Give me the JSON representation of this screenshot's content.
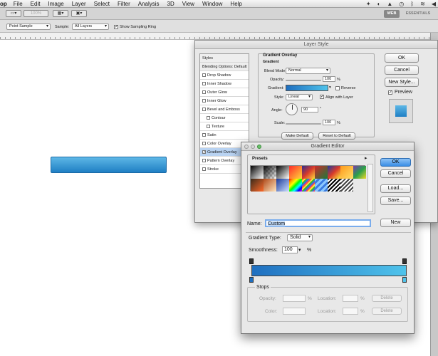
{
  "menubar": {
    "app": "op",
    "items": [
      "File",
      "Edit",
      "Image",
      "Layer",
      "Select",
      "Filter",
      "Analysis",
      "3D",
      "View",
      "Window",
      "Help"
    ]
  },
  "appbar": {
    "zoom_placeholder": "100%",
    "workspace_active": "WEB",
    "workspace_other": "ESSENTIALS"
  },
  "options": {
    "sample_size": "Point Sample",
    "sample_label": "Sample:",
    "sample_value": "All Layers",
    "ring_label": "Show Sampling Ring",
    "ring_checked": true
  },
  "layer_style": {
    "title": "Layer Style",
    "list": [
      {
        "label": "Styles",
        "type": "hdr"
      },
      {
        "label": "Blending Options: Default",
        "type": "hdr"
      },
      {
        "label": "Drop Shadow",
        "type": "chk"
      },
      {
        "label": "Inner Shadow",
        "type": "chk"
      },
      {
        "label": "Outer Glow",
        "type": "chk"
      },
      {
        "label": "Inner Glow",
        "type": "chk"
      },
      {
        "label": "Bevel and Emboss",
        "type": "chk"
      },
      {
        "label": "Contour",
        "type": "sub"
      },
      {
        "label": "Texture",
        "type": "sub"
      },
      {
        "label": "Satin",
        "type": "chk"
      },
      {
        "label": "Color Overlay",
        "type": "chk"
      },
      {
        "label": "Gradient Overlay",
        "type": "active"
      },
      {
        "label": "Pattern Overlay",
        "type": "chk"
      },
      {
        "label": "Stroke",
        "type": "chk"
      }
    ],
    "section_title": "Gradient Overlay",
    "subsection_title": "Gradient",
    "blend_mode_label": "Blend Mode:",
    "blend_mode": "Normal",
    "opacity_label": "Opacity:",
    "opacity": "100",
    "pct": "%",
    "gradient_label": "Gradient:",
    "reverse_label": "Reverse",
    "style_label": "Style:",
    "style": "Linear",
    "align_label": "Align with Layer",
    "angle_label": "Angle:",
    "angle": "90",
    "deg": "°",
    "scale_label": "Scale:",
    "scale": "100",
    "make_default": "Make Default",
    "reset_default": "Reset to Default",
    "ok": "OK",
    "cancel": "Cancel",
    "new_style": "New Style...",
    "preview": "Preview"
  },
  "gradient_editor": {
    "title": "Gradient Editor",
    "presets_label": "Presets",
    "ok": "OK",
    "cancel": "Cancel",
    "load": "Load...",
    "save": "Save...",
    "name_label": "Name:",
    "name_value": "Custom",
    "new": "New",
    "type_label": "Gradient Type:",
    "type_value": "Solid",
    "smooth_label": "Smoothness:",
    "smooth_value": "100",
    "pct": "%",
    "stops_label": "Stops",
    "opacity_label": "Opacity:",
    "color_label": "Color:",
    "location_label": "Location:",
    "delete": "Delete",
    "gradient_colors": [
      "#1f6fc0",
      "#4fc3eb"
    ]
  }
}
